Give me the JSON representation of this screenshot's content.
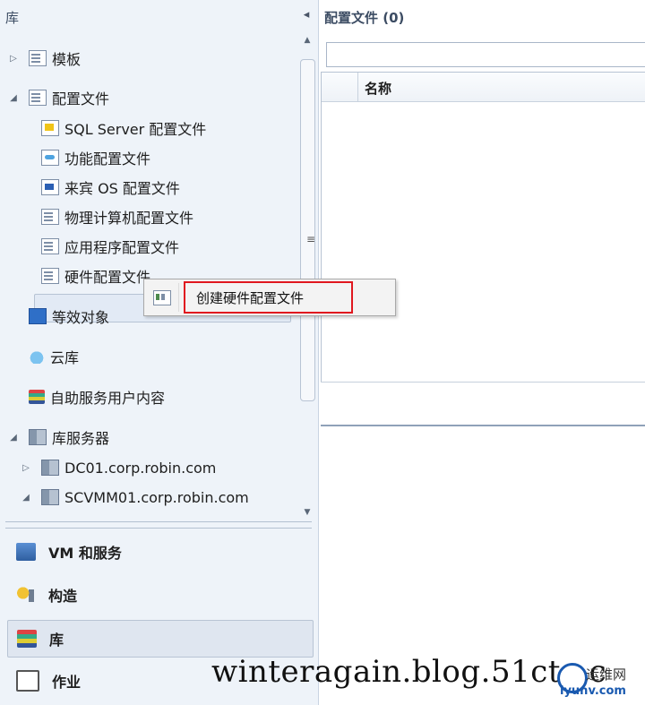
{
  "left_pane": {
    "title": "库",
    "collapse_glyph": "◂",
    "tree": [
      {
        "label": "模板",
        "icon": "template-icon",
        "arrow": "▷"
      },
      {
        "label": "配置文件",
        "icon": "profiles-icon",
        "arrow": "◢"
      },
      {
        "label": "SQL Server 配置文件",
        "icon": "sql-profile-icon"
      },
      {
        "label": "功能配置文件",
        "icon": "capability-profile-icon"
      },
      {
        "label": "来宾 OS 配置文件",
        "icon": "guest-os-profile-icon"
      },
      {
        "label": "物理计算机配置文件",
        "icon": "physical-computer-profile-icon"
      },
      {
        "label": "应用程序配置文件",
        "icon": "application-profile-icon"
      },
      {
        "label": "硬件配置文件",
        "icon": "hardware-profile-icon"
      },
      {
        "label": "等效对象",
        "icon": "equivalent-objects-icon"
      },
      {
        "label": "云库",
        "icon": "cloud-library-icon"
      },
      {
        "label": "自助服务用户内容",
        "icon": "self-service-content-icon"
      },
      {
        "label": "库服务器",
        "icon": "library-servers-icon",
        "arrow": "◢"
      },
      {
        "label": "DC01.corp.robin.com",
        "icon": "server-icon",
        "arrow": "▷"
      },
      {
        "label": "SCVMM01.corp.robin.com",
        "icon": "server-icon",
        "arrow": "◢"
      }
    ],
    "scrollbar": {
      "up": "▲",
      "down": "▼",
      "grip": "≡"
    },
    "workspaces": [
      {
        "label": "VM 和服务",
        "icon": "vms-and-services-icon"
      },
      {
        "label": "构造",
        "icon": "fabric-icon"
      },
      {
        "label": "库",
        "icon": "library-icon",
        "active": true
      },
      {
        "label": "作业",
        "icon": "jobs-icon"
      }
    ]
  },
  "right_pane": {
    "title": "配置文件 (0)",
    "filter_value": "",
    "columns": [
      "名称"
    ]
  },
  "context_menu": {
    "item_label": "创建硬件配置文件",
    "highlight_color": "#e0171f"
  },
  "watermark": {
    "text": "winteragain.blog.51cto.c",
    "logo_text": "运维网",
    "logo_url": "iyunv.com"
  }
}
